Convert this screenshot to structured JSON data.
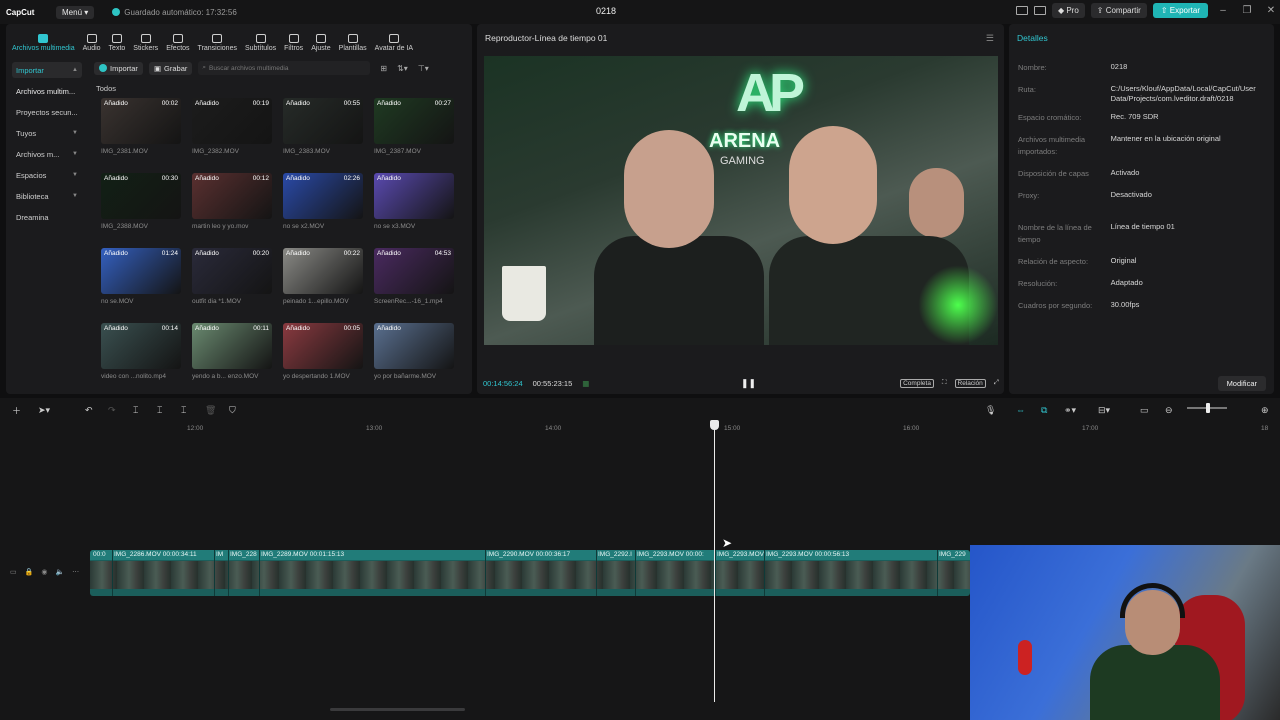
{
  "topbar": {
    "logo": "CapCut",
    "menu": "Menú",
    "autosave": "Guardado automático: 17:32:56",
    "project_title": "0218",
    "pro": "Pro",
    "share": "Compartir",
    "export": "Exportar"
  },
  "tools": [
    {
      "label": "Archivos multimedia",
      "icon": "media-icon"
    },
    {
      "label": "Audio",
      "icon": "audio-icon"
    },
    {
      "label": "Texto",
      "icon": "text-icon"
    },
    {
      "label": "Stickers",
      "icon": "sticker-icon"
    },
    {
      "label": "Efectos",
      "icon": "effects-icon"
    },
    {
      "label": "Transiciones",
      "icon": "transition-icon"
    },
    {
      "label": "Subtítulos",
      "icon": "subtitles-icon"
    },
    {
      "label": "Filtros",
      "icon": "filter-icon"
    },
    {
      "label": "Ajuste",
      "icon": "adjust-icon"
    },
    {
      "label": "Plantillas",
      "icon": "template-icon"
    },
    {
      "label": "Avatar de IA",
      "icon": "avatar-icon"
    }
  ],
  "sidenav": [
    {
      "label": "Importar",
      "caret": "▲"
    },
    {
      "label": "Archivos multim...",
      "caret": ""
    },
    {
      "label": "Proyectos secun...",
      "caret": ""
    },
    {
      "label": "Tuyos",
      "caret": "▼"
    },
    {
      "label": "Archivos m...",
      "caret": "▼"
    },
    {
      "label": "Espacios",
      "caret": "▼"
    },
    {
      "label": "Biblioteca",
      "caret": "▼"
    },
    {
      "label": "Dreamina",
      "caret": ""
    }
  ],
  "mediabar": {
    "import": "Importar",
    "record": "Grabar",
    "search_placeholder": "Buscar archivos multimedia"
  },
  "todos": "Todos",
  "media": [
    {
      "badge": "Añadido",
      "dur": "00:02",
      "name": "IMG_2381.MOV",
      "color": "#3a3330"
    },
    {
      "badge": "Añadido",
      "dur": "00:19",
      "name": "IMG_2382.MOV",
      "color": "#1c1c1c"
    },
    {
      "badge": "Añadido",
      "dur": "00:55",
      "name": "IMG_2383.MOV",
      "color": "#262b28"
    },
    {
      "badge": "Añadido",
      "dur": "00:27",
      "name": "IMG_2387.MOV",
      "color": "#1f3a22"
    },
    {
      "badge": "Añadido",
      "dur": "00:30",
      "name": "IMG_2388.MOV",
      "color": "#122015"
    },
    {
      "badge": "Añadido",
      "dur": "00:12",
      "name": "martin leo y yo.mov",
      "color": "#5a3030"
    },
    {
      "badge": "Añadido",
      "dur": "02:26",
      "name": "no se x2.MOV",
      "color": "#2a4aa8"
    },
    {
      "badge": "Añadido",
      "dur": "",
      "name": "no se x3.MOV",
      "color": "#5a4ab0"
    },
    {
      "badge": "Añadido",
      "dur": "01:24",
      "name": "no se.MOV",
      "color": "#3460c0"
    },
    {
      "badge": "Añadido",
      "dur": "00:20",
      "name": "outfit dia *1.MOV",
      "color": "#2a2a3a"
    },
    {
      "badge": "Añadido",
      "dur": "00:22",
      "name": "peinado 1...epillo.MOV",
      "color": "#8a8a86"
    },
    {
      "badge": "Añadido",
      "dur": "04:53",
      "name": "ScreenRec...-16_1.mp4",
      "color": "#4a2a60"
    },
    {
      "badge": "Añadido",
      "dur": "00:14",
      "name": "video con ...nolito.mp4",
      "color": "#3a5050"
    },
    {
      "badge": "Añadido",
      "dur": "00:11",
      "name": "yendo a b... enzo.MOV",
      "color": "#6a8a70"
    },
    {
      "badge": "Añadido",
      "dur": "00:05",
      "name": "yo despertando 1.MOV",
      "color": "#8a3a40"
    },
    {
      "badge": "Añadido",
      "dur": "",
      "name": "yo por bañarme.MOV",
      "color": "#5a7090"
    }
  ],
  "player": {
    "title": "Reproductor-Línea de tiempo 01",
    "current": "00:14:56:24",
    "total": "00:55:23:15",
    "full": "Completa",
    "ratio": "Relación",
    "sign_ap": "AP",
    "sign_arena": "ARENA",
    "sign_gaming": "GAMING"
  },
  "details": {
    "header": "Detalles",
    "rows": [
      {
        "k": "Nombre:",
        "v": "0218"
      },
      {
        "k": "Ruta:",
        "v": "C:/Users/Klouf/AppData/Local/CapCut/User Data/Projects/com.lveditor.draft/0218"
      },
      {
        "k": "Espacio cromático:",
        "v": "Rec. 709 SDR"
      },
      {
        "k": "Archivos multimedia importados:",
        "v": "Mantener en la ubicación original"
      },
      {
        "k": "Disposición de capas",
        "v": "Activado"
      },
      {
        "k": "Proxy:",
        "v": "Desactivado"
      },
      {
        "k": "Nombre de la línea de tiempo",
        "v": "Línea de tiempo 01"
      },
      {
        "k": "Relación de aspecto:",
        "v": "Original"
      },
      {
        "k": "Resolución:",
        "v": "Adaptado"
      },
      {
        "k": "Cuadros por segundo:",
        "v": "30.00fps"
      }
    ],
    "modify": "Modificar"
  },
  "ruler": [
    "12:00",
    "13:00",
    "14:00",
    "15:00",
    "16:00",
    "17:00",
    "18"
  ],
  "clips": [
    {
      "label": "00:0"
    },
    {
      "label": "IMG_2286.MOV  00:00:34:11"
    },
    {
      "label": "IM"
    },
    {
      "label": "IMG_228"
    },
    {
      "label": "IMG_2289.MOV  00:01:15:13"
    },
    {
      "label": "IMG_2290.MOV  00:00:36:17"
    },
    {
      "label": "IMG_2292.I"
    },
    {
      "label": "IMG_2293.MOV  00:00:"
    },
    {
      "label": "IMG_2293.MOV"
    },
    {
      "label": "IMG_2293.MOV  00:00:56:13"
    },
    {
      "label": "IMG_229"
    }
  ]
}
